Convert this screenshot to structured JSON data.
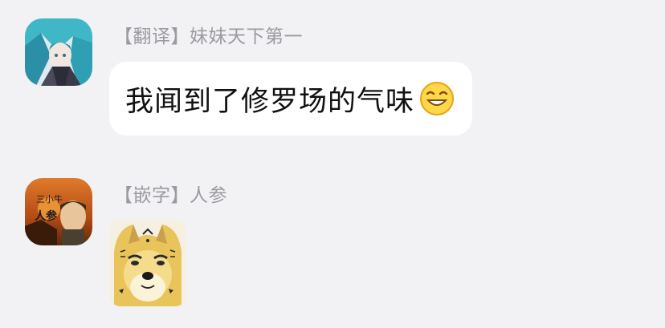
{
  "messages": [
    {
      "sender": "【翻译】妹妹天下第一",
      "text": "我闻到了修罗场的气味",
      "emoji": "grinning-squint-emoji"
    },
    {
      "sender": "【嵌字】人参",
      "avatar_caption": "人参",
      "sticker": "doge-sticker"
    }
  ],
  "colors": {
    "background": "#f2f2f4",
    "bubble": "#ffffff",
    "sender_name": "#9a9aa2",
    "message_text": "#111111"
  }
}
